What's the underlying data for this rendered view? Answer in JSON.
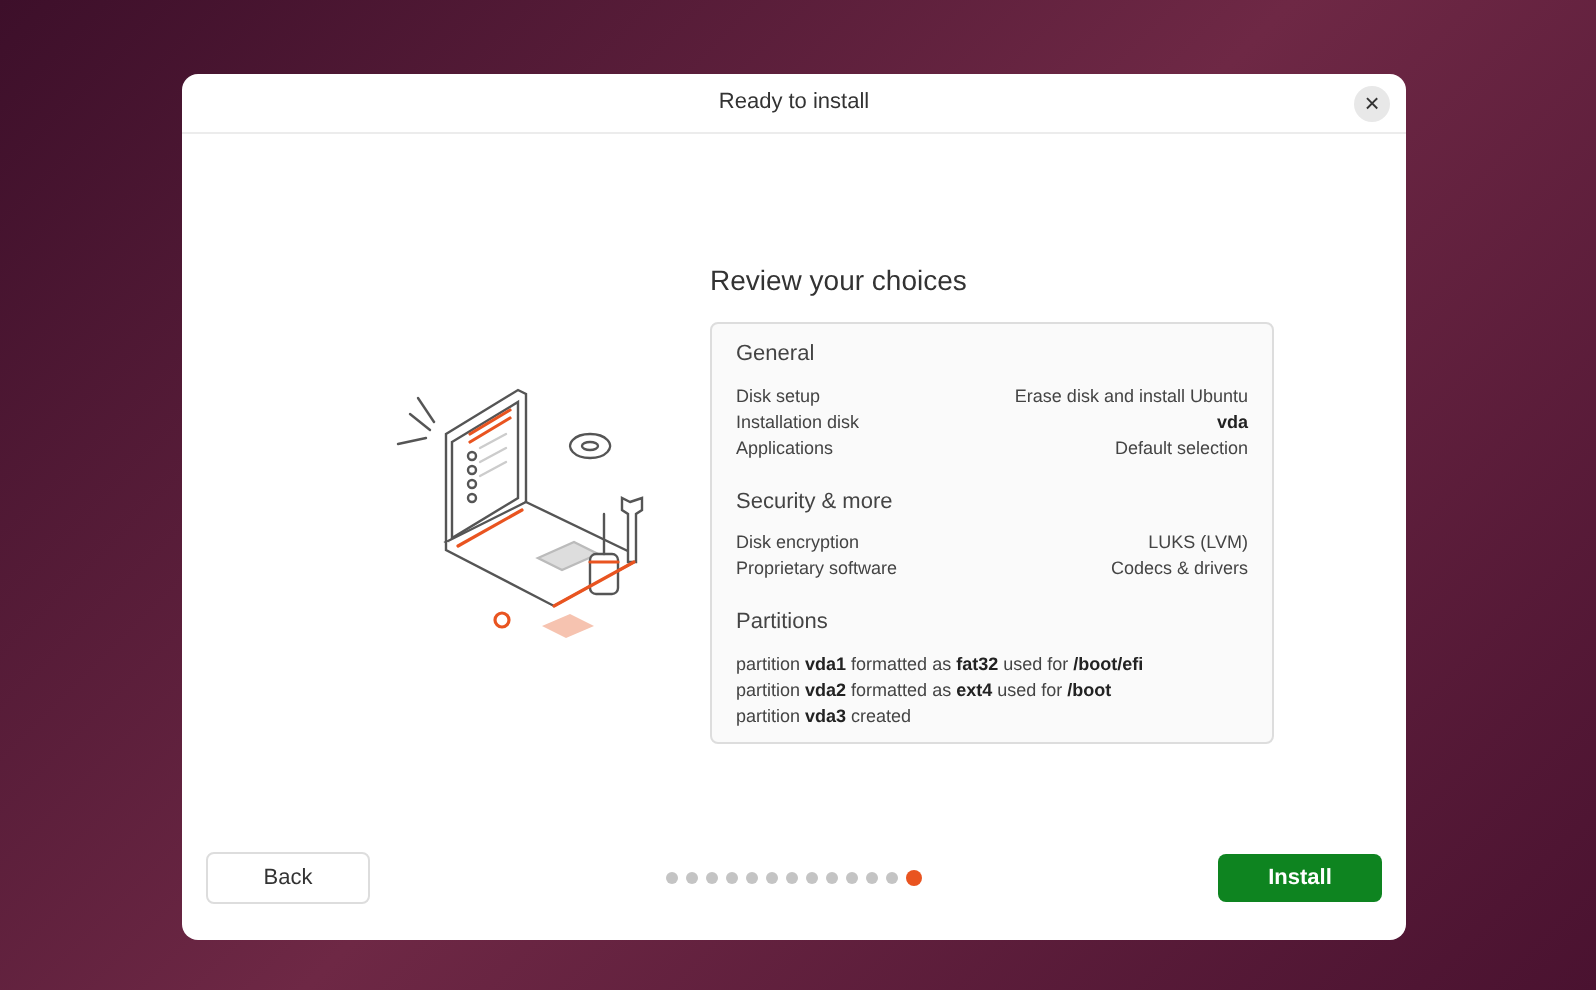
{
  "window": {
    "title": "Ready to install",
    "close": "×"
  },
  "review": {
    "heading": "Review your choices",
    "sections": [
      {
        "title": "General",
        "kind": "pairs",
        "rows": [
          {
            "label": "Disk setup",
            "value": "Erase disk and install Ubuntu",
            "bold": false
          },
          {
            "label": "Installation disk",
            "value": "vda",
            "bold": true
          },
          {
            "label": "Applications",
            "value": "Default selection",
            "bold": false
          }
        ]
      },
      {
        "title": "Security & more",
        "kind": "pairs",
        "rows": [
          {
            "label": "Disk encryption",
            "value": "LUKS (LVM)",
            "bold": false
          },
          {
            "label": "Proprietary software",
            "value": "Codecs & drivers",
            "bold": false
          }
        ]
      },
      {
        "title": "Partitions",
        "kind": "lines",
        "lines": [
          "partition **vda1** formatted as **fat32** used for **/boot/efi**",
          "partition **vda2** formatted as **ext4** used for **/boot**",
          "partition **vda3** created"
        ]
      }
    ]
  },
  "footer": {
    "back": "Back",
    "install": "Install",
    "pages": [
      {
        "selected": false
      },
      {
        "selected": false
      },
      {
        "selected": false
      },
      {
        "selected": false
      },
      {
        "selected": false
      },
      {
        "selected": false
      },
      {
        "selected": false
      },
      {
        "selected": false
      },
      {
        "selected": false
      },
      {
        "selected": false
      },
      {
        "selected": false
      },
      {
        "selected": false
      },
      {
        "selected": true
      }
    ]
  }
}
